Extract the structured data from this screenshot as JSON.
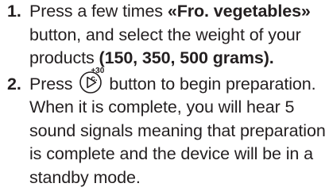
{
  "steps": [
    {
      "number": "1.",
      "line1_pre": "Press a few times ",
      "line1_bold": "«Fro. vegetables»",
      "line2": "button, and select the weight of your",
      "line3_pre": "products ",
      "line3_bold": "(150, 350, 500 grams)."
    },
    {
      "number": "2.",
      "line1_pre": "Press ",
      "icon_label": "+30 c.",
      "icon_name": "start-play-icon",
      "line1_post": "button to begin preparation.",
      "line2": "When it is complete, you will hear 5",
      "line3": "sound signals meaning that preparation",
      "line4": "is complete and the device will be in a",
      "line5": "standby mode."
    }
  ]
}
